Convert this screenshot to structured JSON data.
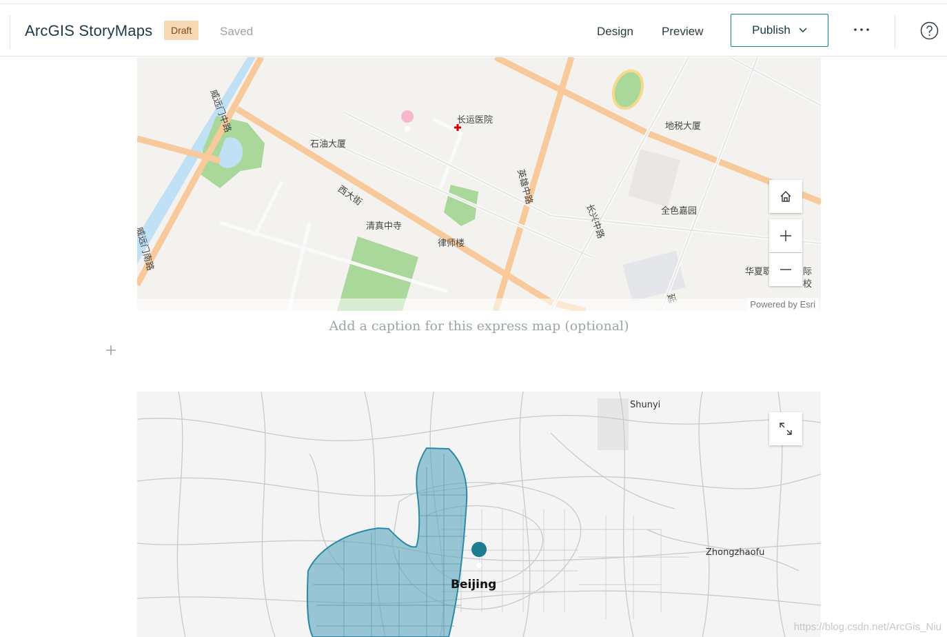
{
  "header": {
    "app_title": "ArcGIS StoryMaps",
    "draft_badge": "Draft",
    "saved_status": "Saved",
    "design_label": "Design",
    "preview_label": "Preview",
    "publish_label": "Publish"
  },
  "map1": {
    "labels": [
      "长运医院",
      "石油大厦",
      "地税大厦",
      "西大街",
      "清真中寺",
      "律师楼",
      "英雄中路",
      "长兴中路",
      "全色嘉园",
      "华夏职",
      "际",
      "校",
      "威远门中路",
      "威远门南路",
      "延"
    ],
    "attribution": "Powered by Esri"
  },
  "caption": {
    "placeholder": "Add a caption for this express map (optional)"
  },
  "map2": {
    "labels": {
      "shunyi": "Shunyi",
      "zhongzhaofu": "Zhongzhaofu",
      "beijing": "Beijing"
    },
    "area_color": "#5ea8bf"
  },
  "watermark": "https://blog.csdn.net/ArcGis_Niu",
  "icons": [
    "chevron-down-icon",
    "more-icon",
    "help-icon",
    "home-icon",
    "zoom-in-icon",
    "zoom-out-icon",
    "expand-icon",
    "plus-icon",
    "map-pin-icon"
  ]
}
